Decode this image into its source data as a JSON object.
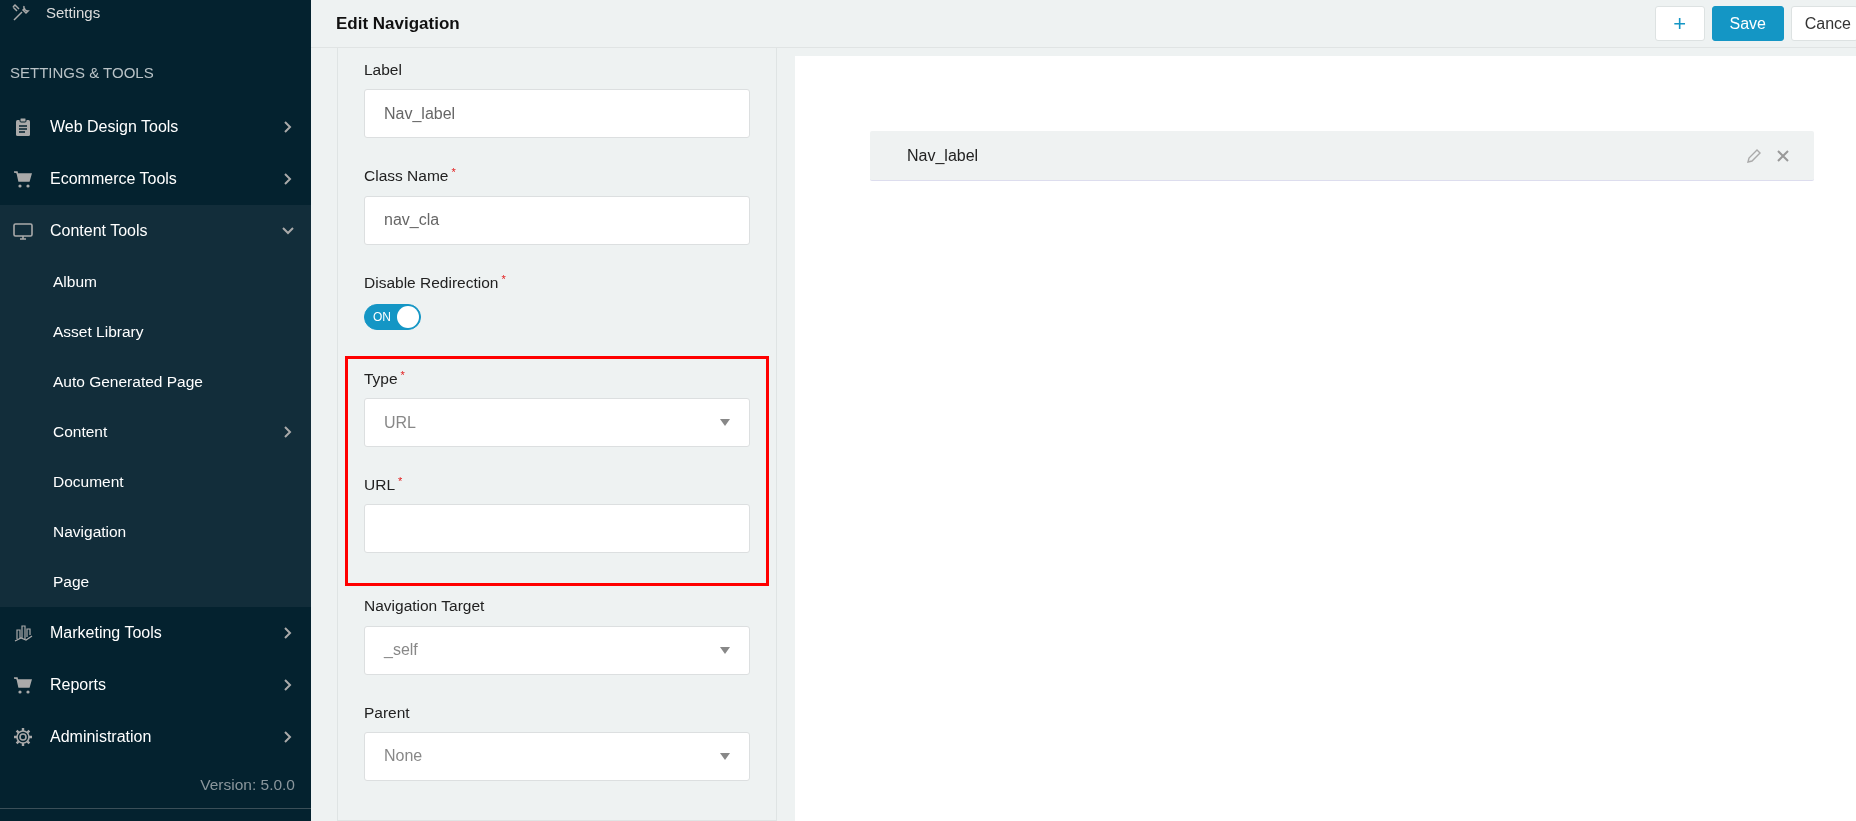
{
  "sidebar": {
    "top_item": {
      "label": "Settings"
    },
    "section_title": "SETTINGS & TOOLS",
    "items": [
      {
        "label": "Web Design Tools",
        "expanded": false
      },
      {
        "label": "Ecommerce Tools",
        "expanded": false
      },
      {
        "label": "Content Tools",
        "expanded": true,
        "children": [
          {
            "label": "Album",
            "has_submenu": false
          },
          {
            "label": "Asset Library",
            "has_submenu": false
          },
          {
            "label": "Auto Generated Page",
            "has_submenu": false
          },
          {
            "label": "Content",
            "has_submenu": true
          },
          {
            "label": "Document",
            "has_submenu": false
          },
          {
            "label": "Navigation",
            "has_submenu": false
          },
          {
            "label": "Page",
            "has_submenu": false
          }
        ]
      },
      {
        "label": "Marketing Tools",
        "expanded": false
      },
      {
        "label": "Reports",
        "expanded": false
      },
      {
        "label": "Administration",
        "expanded": false
      }
    ],
    "version": "Version: 5.0.0"
  },
  "header": {
    "title": "Edit Navigation",
    "buttons": [
      {
        "kind": "add",
        "label": "+"
      },
      {
        "kind": "primary",
        "label": "Save"
      },
      {
        "kind": "plain",
        "label": "Cance"
      }
    ]
  },
  "form": {
    "fields": [
      {
        "kind": "text",
        "label": "Label",
        "value": "Nav_label",
        "highlighted": false
      },
      {
        "kind": "text",
        "label": "Class Name",
        "required_mark": "*",
        "value": "nav_cla",
        "highlighted": false
      },
      {
        "kind": "toggle",
        "label": "Disable Redirection",
        "required_mark": "*",
        "on": true,
        "toggle_text": "ON",
        "highlighted": false
      },
      {
        "kind": "select",
        "label": "Type",
        "required_mark": "*",
        "value": "URL",
        "highlighted": true
      },
      {
        "kind": "text",
        "label": "URL",
        "required_mark": "*",
        "highlighted": true
      },
      {
        "kind": "select",
        "label": "Navigation Target",
        "value": "_self",
        "highlighted": false
      },
      {
        "kind": "select",
        "label": "Parent",
        "value": "None",
        "highlighted": false
      }
    ]
  },
  "preview": {
    "items": [
      {
        "label": "Nav_label"
      }
    ]
  }
}
